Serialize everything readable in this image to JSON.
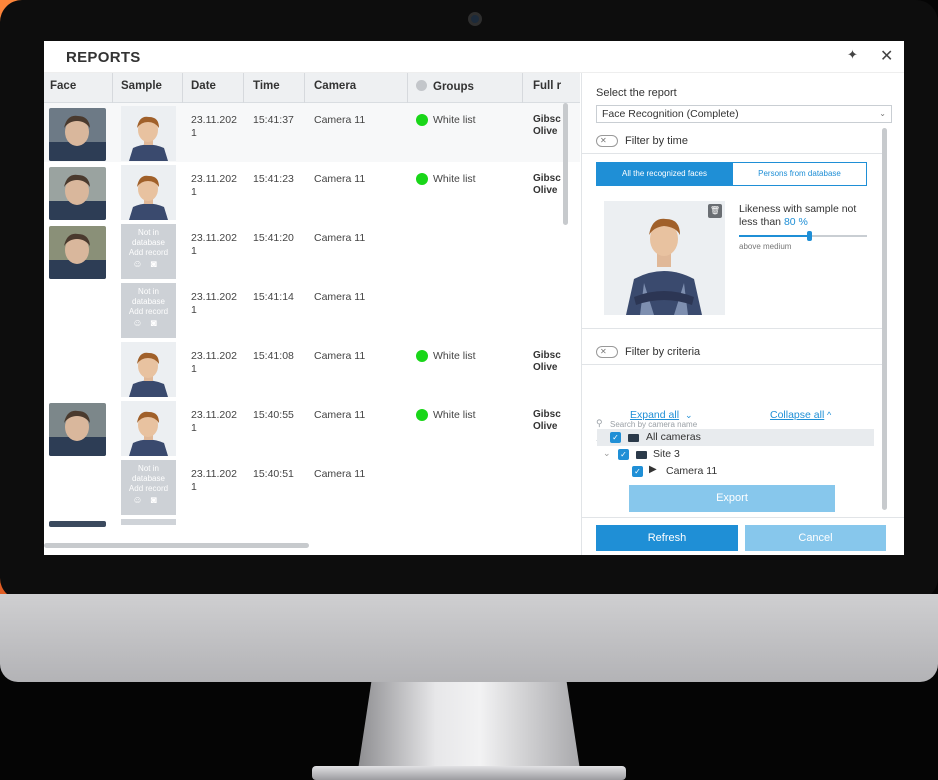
{
  "window": {
    "title": "REPORTS",
    "pin_icon": "pin-icon",
    "close_icon": "close-icon"
  },
  "table": {
    "columns": [
      "Face",
      "Sample",
      "Date",
      "Time",
      "Camera",
      "Groups",
      "Full r"
    ],
    "rows": [
      {
        "face": true,
        "sample": "photo",
        "date": "23.11.202\n1",
        "time": "15:41:37",
        "camera": "Camera 11",
        "group": "White list",
        "name": "Gibsc\nOlive"
      },
      {
        "face": true,
        "sample": "photo",
        "date": "23.11.202\n1",
        "time": "15:41:23",
        "camera": "Camera 11",
        "group": "White list",
        "name": "Gibsc\nOlive"
      },
      {
        "face": true,
        "sample": "nodb",
        "date": "23.11.202\n1",
        "time": "15:41:20",
        "camera": "Camera 11",
        "group": "",
        "name": ""
      },
      {
        "face": false,
        "sample": "nodb",
        "date": "23.11.202\n1",
        "time": "15:41:14",
        "camera": "Camera 11",
        "group": "",
        "name": ""
      },
      {
        "face": false,
        "sample": "photo",
        "date": "23.11.202\n1",
        "time": "15:41:08",
        "camera": "Camera 11",
        "group": "White list",
        "name": "Gibsc\nOlive"
      },
      {
        "face": true,
        "sample": "photo",
        "date": "23.11.202\n1",
        "time": "15:40:55",
        "camera": "Camera 11",
        "group": "White list",
        "name": "Gibsc\nOlive"
      },
      {
        "face": false,
        "sample": "nodb",
        "date": "23.11.202\n1",
        "time": "15:40:51",
        "camera": "Camera 11",
        "group": "",
        "name": ""
      }
    ],
    "not_in_db": {
      "line1": "Not in",
      "line2": "database",
      "add": "Add record",
      "icons": [
        "face-icon",
        "camera-icon"
      ]
    }
  },
  "panel": {
    "select_label": "Select the report",
    "select_value": "Face Recognition (Complete)",
    "filter_time": "Filter by time",
    "tab_all": "All the recognized faces",
    "tab_db": "Persons from database",
    "likeness_text": "Likeness with sample not less than",
    "likeness_value": "80 %",
    "likeness_level": 0.8,
    "slider_label": "above medium",
    "filter_criteria": "Filter by criteria",
    "search_placeholder": "Search by camera name",
    "expand_all": "Expand all",
    "collapse_all": "Collapse all",
    "tree": [
      {
        "label": "All cameras",
        "type": "folder",
        "checked": true
      },
      {
        "label": "Site 3",
        "type": "folder",
        "checked": true
      },
      {
        "label": "Camera 11",
        "type": "camera",
        "checked": true
      }
    ],
    "export": "Export",
    "refresh": "Refresh",
    "cancel": "Cancel"
  },
  "colors": {
    "accent": "#1f8fd6",
    "accent_light": "#87c7ec",
    "status_green": "#19d619",
    "background_orange": "#f26a2a"
  }
}
